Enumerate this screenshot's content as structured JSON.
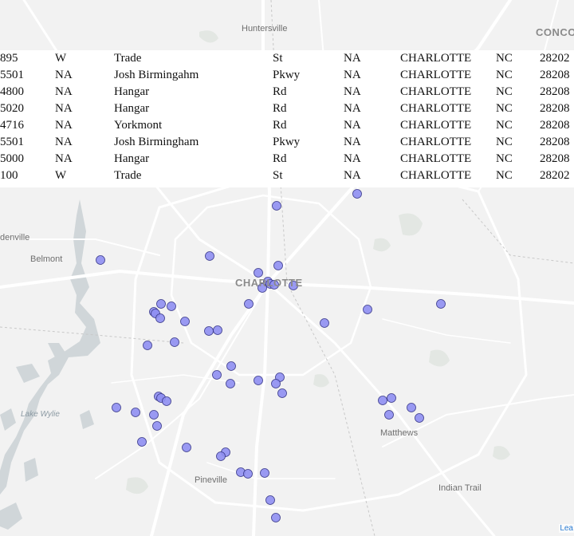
{
  "map": {
    "colors": {
      "land": "#f2f2f2",
      "water": "#d0d6d9",
      "road": "#ffffff",
      "park": "#e3e7e3",
      "marker_fill": "#8f8ff2",
      "marker_fill_dense": "#6f6fe6",
      "marker_stroke": "#3a3a8a"
    },
    "place_labels": [
      {
        "name": "Huntersville",
        "kind": "town"
      },
      {
        "name": "CONCO",
        "kind": "big"
      },
      {
        "name": "denville",
        "kind": "town"
      },
      {
        "name": "Belmont",
        "kind": "town"
      },
      {
        "name": "CHARLOTTE",
        "kind": "big"
      },
      {
        "name": "Lake Wylie",
        "kind": "water"
      },
      {
        "name": "Matthews",
        "kind": "town"
      },
      {
        "name": "Pineville",
        "kind": "town"
      },
      {
        "name": "Indian Trail",
        "kind": "town"
      }
    ],
    "attribution": "Lea"
  },
  "address_table": {
    "rows": [
      [
        "895",
        "W",
        "Trade",
        "St",
        "NA",
        "CHARLOTTE",
        "NC",
        "28202"
      ],
      [
        "5501",
        "NA",
        "Josh Birmingahm",
        "Pkwy",
        "NA",
        "CHARLOTTE",
        "NC",
        "28208"
      ],
      [
        "4800",
        "NA",
        "Hangar",
        "Rd",
        "NA",
        "CHARLOTTE",
        "NC",
        "28208"
      ],
      [
        "5020",
        "NA",
        "Hangar",
        "Rd",
        "NA",
        "CHARLOTTE",
        "NC",
        "28208"
      ],
      [
        "4716",
        "NA",
        "Yorkmont",
        "Rd",
        "NA",
        "CHARLOTTE",
        "NC",
        "28208"
      ],
      [
        "5501",
        "NA",
        "Josh Birmingham",
        "Pkwy",
        "NA",
        "CHARLOTTE",
        "NC",
        "28208"
      ],
      [
        "5000",
        "NA",
        "Hangar",
        "Rd",
        "NA",
        "CHARLOTTE",
        "NC",
        "28208"
      ],
      [
        "100",
        "W",
        "Trade",
        "St",
        "NA",
        "CHARLOTTE",
        "NC",
        "28202"
      ]
    ]
  }
}
